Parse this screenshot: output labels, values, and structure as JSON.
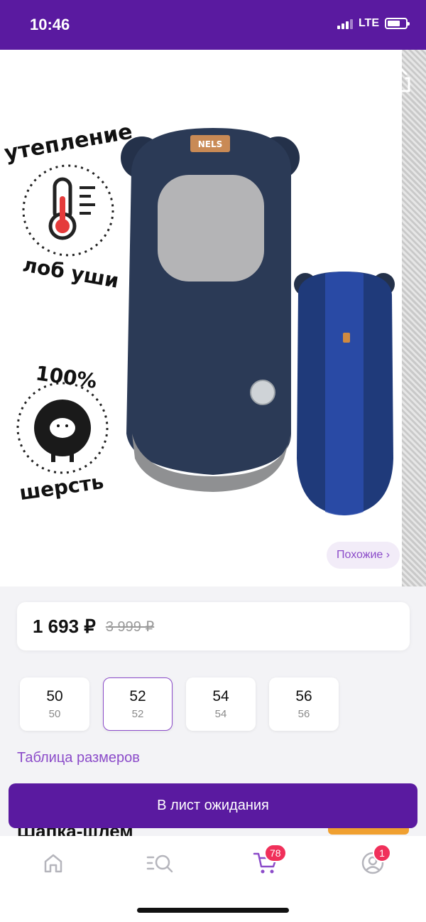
{
  "status": {
    "time": "10:46",
    "network": "LTE"
  },
  "image_overlay": {
    "badge_warm_top": "утепление",
    "badge_warm_bottom": "лоб уши",
    "badge_wool_top": "100%",
    "badge_wool_bottom": "шерсть",
    "brand_logo": "NELS",
    "similar_label": "Похожие ›"
  },
  "price": {
    "current": "1 693 ₽",
    "old": "3 999 ₽"
  },
  "sizes": [
    {
      "main": "50",
      "sub": "50",
      "selected": false
    },
    {
      "main": "52",
      "sub": "52",
      "selected": true
    },
    {
      "main": "54",
      "sub": "54",
      "selected": false
    },
    {
      "main": "56",
      "sub": "56",
      "selected": false
    }
  ],
  "size_table_label": "Таблица размеров",
  "waitlist_label": "В лист ожидания",
  "product_title_peek": "Шапка-шлем",
  "tab_bar": {
    "cart_badge": "78",
    "profile_badge": "1"
  },
  "colors": {
    "brand_purple": "#5a1aa0",
    "accent_purple": "#8b4bc9",
    "badge_red": "#f0305a"
  }
}
